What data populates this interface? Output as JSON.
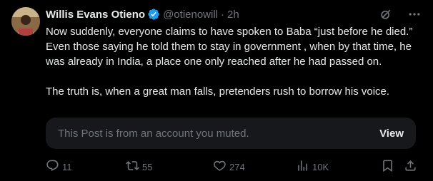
{
  "tweet": {
    "author_name": "Willis Evans Otieno",
    "handle": "@otienowill",
    "separator": "·",
    "time": "2h",
    "paragraphs": [
      "Now suddenly, everyone claims to have spoken to Baba “just before he died.”",
      "Even those saying he told them to stay in government , when by that time, he was already in India, a place one only reached after he had passed on.",
      "",
      "The truth is, when a great man falls, pretenders rush to borrow his voice."
    ]
  },
  "muted_notice": {
    "text": "This Post is from an account you muted.",
    "button_label": "View"
  },
  "actions": {
    "replies": "11",
    "reposts": "55",
    "likes": "274",
    "views": "10K"
  },
  "icons": {
    "verified": "verified-badge-icon",
    "grok": "grok-icon",
    "more": "more-icon",
    "reply": "reply-icon",
    "repost": "repost-icon",
    "like": "heart-icon",
    "views": "views-icon",
    "bookmark": "bookmark-icon",
    "share": "share-icon"
  },
  "colors": {
    "background": "#000000",
    "text": "#e7e9ea",
    "secondary": "#71767b",
    "verified": "#1d9bf0",
    "muted_box": "#16181c"
  }
}
